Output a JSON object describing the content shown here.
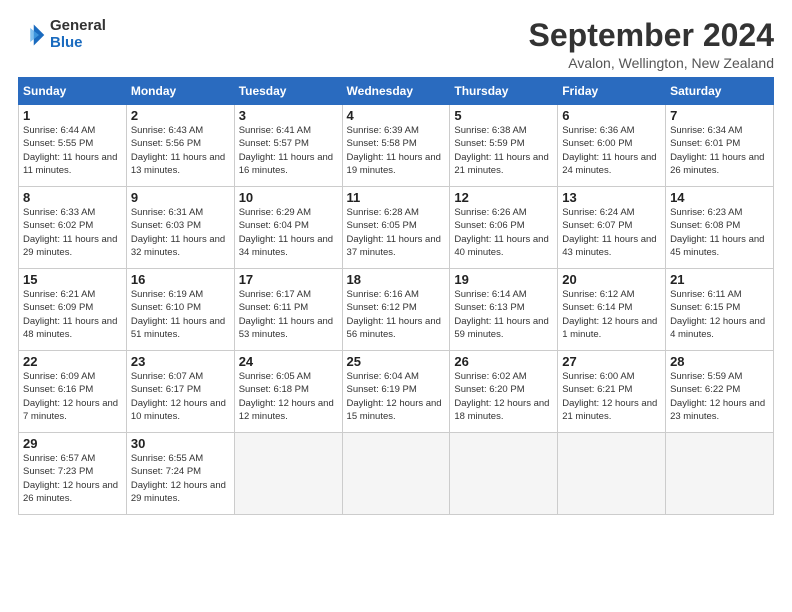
{
  "header": {
    "logo_line1": "General",
    "logo_line2": "Blue",
    "month": "September 2024",
    "location": "Avalon, Wellington, New Zealand"
  },
  "days_of_week": [
    "Sunday",
    "Monday",
    "Tuesday",
    "Wednesday",
    "Thursday",
    "Friday",
    "Saturday"
  ],
  "weeks": [
    [
      {
        "num": "1",
        "sunrise": "6:44 AM",
        "sunset": "5:55 PM",
        "daylight": "11 hours and 11 minutes."
      },
      {
        "num": "2",
        "sunrise": "6:43 AM",
        "sunset": "5:56 PM",
        "daylight": "11 hours and 13 minutes."
      },
      {
        "num": "3",
        "sunrise": "6:41 AM",
        "sunset": "5:57 PM",
        "daylight": "11 hours and 16 minutes."
      },
      {
        "num": "4",
        "sunrise": "6:39 AM",
        "sunset": "5:58 PM",
        "daylight": "11 hours and 19 minutes."
      },
      {
        "num": "5",
        "sunrise": "6:38 AM",
        "sunset": "5:59 PM",
        "daylight": "11 hours and 21 minutes."
      },
      {
        "num": "6",
        "sunrise": "6:36 AM",
        "sunset": "6:00 PM",
        "daylight": "11 hours and 24 minutes."
      },
      {
        "num": "7",
        "sunrise": "6:34 AM",
        "sunset": "6:01 PM",
        "daylight": "11 hours and 26 minutes."
      }
    ],
    [
      {
        "num": "8",
        "sunrise": "6:33 AM",
        "sunset": "6:02 PM",
        "daylight": "11 hours and 29 minutes."
      },
      {
        "num": "9",
        "sunrise": "6:31 AM",
        "sunset": "6:03 PM",
        "daylight": "11 hours and 32 minutes."
      },
      {
        "num": "10",
        "sunrise": "6:29 AM",
        "sunset": "6:04 PM",
        "daylight": "11 hours and 34 minutes."
      },
      {
        "num": "11",
        "sunrise": "6:28 AM",
        "sunset": "6:05 PM",
        "daylight": "11 hours and 37 minutes."
      },
      {
        "num": "12",
        "sunrise": "6:26 AM",
        "sunset": "6:06 PM",
        "daylight": "11 hours and 40 minutes."
      },
      {
        "num": "13",
        "sunrise": "6:24 AM",
        "sunset": "6:07 PM",
        "daylight": "11 hours and 43 minutes."
      },
      {
        "num": "14",
        "sunrise": "6:23 AM",
        "sunset": "6:08 PM",
        "daylight": "11 hours and 45 minutes."
      }
    ],
    [
      {
        "num": "15",
        "sunrise": "6:21 AM",
        "sunset": "6:09 PM",
        "daylight": "11 hours and 48 minutes."
      },
      {
        "num": "16",
        "sunrise": "6:19 AM",
        "sunset": "6:10 PM",
        "daylight": "11 hours and 51 minutes."
      },
      {
        "num": "17",
        "sunrise": "6:17 AM",
        "sunset": "6:11 PM",
        "daylight": "11 hours and 53 minutes."
      },
      {
        "num": "18",
        "sunrise": "6:16 AM",
        "sunset": "6:12 PM",
        "daylight": "11 hours and 56 minutes."
      },
      {
        "num": "19",
        "sunrise": "6:14 AM",
        "sunset": "6:13 PM",
        "daylight": "11 hours and 59 minutes."
      },
      {
        "num": "20",
        "sunrise": "6:12 AM",
        "sunset": "6:14 PM",
        "daylight": "12 hours and 1 minute."
      },
      {
        "num": "21",
        "sunrise": "6:11 AM",
        "sunset": "6:15 PM",
        "daylight": "12 hours and 4 minutes."
      }
    ],
    [
      {
        "num": "22",
        "sunrise": "6:09 AM",
        "sunset": "6:16 PM",
        "daylight": "12 hours and 7 minutes."
      },
      {
        "num": "23",
        "sunrise": "6:07 AM",
        "sunset": "6:17 PM",
        "daylight": "12 hours and 10 minutes."
      },
      {
        "num": "24",
        "sunrise": "6:05 AM",
        "sunset": "6:18 PM",
        "daylight": "12 hours and 12 minutes."
      },
      {
        "num": "25",
        "sunrise": "6:04 AM",
        "sunset": "6:19 PM",
        "daylight": "12 hours and 15 minutes."
      },
      {
        "num": "26",
        "sunrise": "6:02 AM",
        "sunset": "6:20 PM",
        "daylight": "12 hours and 18 minutes."
      },
      {
        "num": "27",
        "sunrise": "6:00 AM",
        "sunset": "6:21 PM",
        "daylight": "12 hours and 21 minutes."
      },
      {
        "num": "28",
        "sunrise": "5:59 AM",
        "sunset": "6:22 PM",
        "daylight": "12 hours and 23 minutes."
      }
    ],
    [
      {
        "num": "29",
        "sunrise": "6:57 AM",
        "sunset": "7:23 PM",
        "daylight": "12 hours and 26 minutes."
      },
      {
        "num": "30",
        "sunrise": "6:55 AM",
        "sunset": "7:24 PM",
        "daylight": "12 hours and 29 minutes."
      },
      null,
      null,
      null,
      null,
      null
    ]
  ]
}
